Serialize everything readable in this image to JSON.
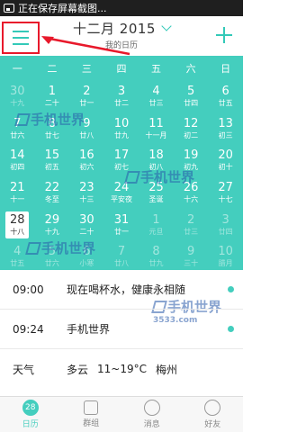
{
  "status_bar": {
    "notification": "正在保存屏幕截图..."
  },
  "header": {
    "title": "十二月 2015",
    "subtitle": "我的日历"
  },
  "calendar": {
    "weekdays": [
      "一",
      "二",
      "三",
      "四",
      "五",
      "六",
      "日"
    ],
    "weeks": [
      [
        {
          "d": "30",
          "l": "十九",
          "dim": true
        },
        {
          "d": "1",
          "l": "二十"
        },
        {
          "d": "2",
          "l": "廿一"
        },
        {
          "d": "3",
          "l": "廿二"
        },
        {
          "d": "4",
          "l": "廿三"
        },
        {
          "d": "5",
          "l": "廿四"
        },
        {
          "d": "6",
          "l": "廿五"
        }
      ],
      [
        {
          "d": "7",
          "l": "廿六"
        },
        {
          "d": "8",
          "l": "廿七"
        },
        {
          "d": "9",
          "l": "廿八"
        },
        {
          "d": "10",
          "l": "廿九"
        },
        {
          "d": "11",
          "l": "十一月"
        },
        {
          "d": "12",
          "l": "初二"
        },
        {
          "d": "13",
          "l": "初三"
        }
      ],
      [
        {
          "d": "14",
          "l": "初四"
        },
        {
          "d": "15",
          "l": "初五"
        },
        {
          "d": "16",
          "l": "初六"
        },
        {
          "d": "17",
          "l": "初七"
        },
        {
          "d": "18",
          "l": "初八"
        },
        {
          "d": "19",
          "l": "初九"
        },
        {
          "d": "20",
          "l": "初十"
        }
      ],
      [
        {
          "d": "21",
          "l": "十一"
        },
        {
          "d": "22",
          "l": "冬至"
        },
        {
          "d": "23",
          "l": "十三"
        },
        {
          "d": "24",
          "l": "平安夜"
        },
        {
          "d": "25",
          "l": "圣诞"
        },
        {
          "d": "26",
          "l": "十六"
        },
        {
          "d": "27",
          "l": "十七"
        }
      ],
      [
        {
          "d": "28",
          "l": "十八",
          "today": true
        },
        {
          "d": "29",
          "l": "十九"
        },
        {
          "d": "30",
          "l": "二十"
        },
        {
          "d": "31",
          "l": "廿一"
        },
        {
          "d": "1",
          "l": "元旦",
          "dim": true
        },
        {
          "d": "2",
          "l": "廿三",
          "dim": true
        },
        {
          "d": "3",
          "l": "廿四",
          "dim": true
        }
      ],
      [
        {
          "d": "4",
          "l": "廿五",
          "dim": true
        },
        {
          "d": "5",
          "l": "廿六",
          "dim": true
        },
        {
          "d": "6",
          "l": "小寒",
          "dim": true
        },
        {
          "d": "7",
          "l": "廿八",
          "dim": true
        },
        {
          "d": "8",
          "l": "廿九",
          "dim": true
        },
        {
          "d": "9",
          "l": "三十",
          "dim": true
        },
        {
          "d": "10",
          "l": "腊月",
          "dim": true
        }
      ]
    ]
  },
  "watermark": {
    "text": "手机世界",
    "sub": "3533.com"
  },
  "events": [
    {
      "time": "09:00",
      "text": "现在喝杯水，健康永相随"
    },
    {
      "time": "09:24",
      "text": "手机世界"
    }
  ],
  "weather": {
    "label": "天气",
    "condition": "多云",
    "temp": "11~19°C",
    "city": "梅州"
  },
  "tabs": [
    {
      "label": "日历",
      "icon": "calendar-icon",
      "badge": "28",
      "active": true
    },
    {
      "label": "群组",
      "icon": "group-icon"
    },
    {
      "label": "消息",
      "icon": "message-icon"
    },
    {
      "label": "好友",
      "icon": "friend-icon"
    }
  ],
  "colors": {
    "accent": "#44cebe",
    "highlight": "#e8192b"
  }
}
